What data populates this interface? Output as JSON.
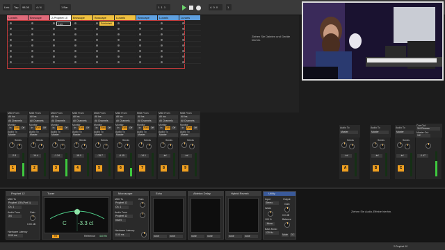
{
  "topbar": {
    "link_label": "Link",
    "tap_label": "Tap",
    "tempo": "98.00",
    "time_sig": "4 / 4",
    "quantize": "1 Bar",
    "position": "1. 1. 1",
    "loop_start": "4. 0. 0",
    "zoom": "1"
  },
  "tracks": [
    {
      "name": "Lunaris",
      "color": "#e06a7a",
      "text": "#111"
    },
    {
      "name": "Broscape",
      "color": "#e06a7a",
      "text": "#111"
    },
    {
      "name": "2-Prophet 10",
      "color": "#ffffff",
      "text": "#111"
    },
    {
      "name": "Broscape",
      "color": "#f0c040",
      "text": "#111"
    },
    {
      "name": "Broscape",
      "color": "#f0c040",
      "text": "#111"
    },
    {
      "name": "Lunaris",
      "color": "#f0c040",
      "text": "#111"
    },
    {
      "name": "Broscape",
      "color": "#5fa0e0",
      "text": "#111"
    },
    {
      "name": "Lunaris",
      "color": "#5fa0e0",
      "text": "#111"
    },
    {
      "name": "Lunaris",
      "color": "#5fa0e0",
      "text": "#111"
    }
  ],
  "clips": [
    {
      "track": 2,
      "label": "Live"
    },
    {
      "track": 4,
      "label": "Schönheit 2.1"
    }
  ],
  "session_hint": "Ziehen Sie Dateien und Geräte hierhin.",
  "io": {
    "midi_from": "MIDI From",
    "all_ins": "All Ins",
    "all_channels": "All Channels",
    "monitor": "Monitor",
    "in": "In",
    "auto": "Auto",
    "off": "Off",
    "audio_to": "Audio To",
    "master": "Master",
    "cue_out": "Cue Out",
    "cue_out_value": "3/4 Phones",
    "master_out": "Master Out",
    "master_out_value": "1/2"
  },
  "mixer": {
    "sends_label": "Sends",
    "strips": [
      {
        "vol": "-2.8",
        "num": "1",
        "color": "#f0a020",
        "level": 0.55
      },
      {
        "vol": "-14.4",
        "num": "2",
        "color": "#f0a020",
        "level": 0.0
      },
      {
        "vol": "-1.24",
        "num": "3",
        "color": "#f0a020",
        "level": 0.75
      },
      {
        "vol": "-18.0",
        "num": "4",
        "color": "#f0a020",
        "level": 0.0
      },
      {
        "vol": "-15.7",
        "num": "5",
        "color": "#f0a020",
        "level": 0.0
      },
      {
        "vol": "-6.15",
        "num": "6",
        "color": "#f0a020",
        "level": 0.35
      },
      {
        "vol": "-14.1",
        "num": "7",
        "color": "#f0a020",
        "level": 0.0
      },
      {
        "vol": "-inf",
        "num": "8",
        "color": "#f0a020",
        "level": 0.0
      },
      {
        "vol": "-inf",
        "num": "9",
        "color": "#f0a020",
        "level": 0.0
      }
    ],
    "returns": [
      {
        "vol": "-inf",
        "num": "A",
        "color": "#f0a020"
      },
      {
        "vol": "-inf",
        "num": "B",
        "color": "#f0a020"
      },
      {
        "vol": "-inf",
        "num": "C",
        "color": "#f0a020"
      }
    ],
    "master": {
      "vol": "-1.47",
      "level": 0.6
    }
  },
  "devices": {
    "prophet": {
      "title": "Prophet 12",
      "midi_to": "MIDI To",
      "midi_to_value": "Prophet 12B (Port 1)",
      "channel": "Ch. 1",
      "audio_from": "Audio From",
      "audio_from_value": "3/4",
      "gain": "Gain",
      "gain_value": "0.00 dB",
      "latency_label": "Hardware Latency",
      "latency_value": "0.00 ms"
    },
    "tuner": {
      "title": "Tuner",
      "note": "C",
      "cents": "-3.3 ct",
      "ref_label": "Reference",
      "ref_value": "440 Hz",
      "hz": "Hz"
    },
    "microscope": {
      "title": "Microscope",
      "midi_to": "MIDI To",
      "midi_to_value": "Prophet 12",
      "channel": "Ch. 1",
      "audio_from": "Audio From",
      "audio_from_value": "Prophet 12",
      "insert": "Insert",
      "gain": "Gain",
      "latency_label": "Hardware Latency",
      "latency_value": "0.00 ms"
    },
    "echo": {
      "title": "Echo",
      "none": "none"
    },
    "delay": {
      "title": "Ableton Delay",
      "none": "none"
    },
    "reverb": {
      "title": "Hybrid Reverb",
      "none": "none"
    },
    "utility": {
      "title": "Utility",
      "input": "Input",
      "input_value": "Stereo",
      "width": "Width",
      "width_value": "100 %",
      "mono": "Mono",
      "bass_mono": "Bass Mono",
      "bass_value": "120 Hz",
      "output": "Output",
      "gain": "Gain",
      "gain_value": "0.0 dB",
      "balance": "Balance",
      "mute": "Mute",
      "dc": "DC"
    },
    "audio_effects_hint": "Ziehen Sie Audio-Effekte hierhin."
  },
  "status": {
    "track_name": "2-Prophet 10"
  }
}
